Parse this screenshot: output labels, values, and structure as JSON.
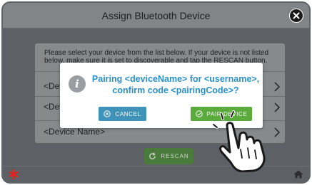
{
  "window": {
    "title": "Assign Bluetooth Device"
  },
  "list": {
    "instructions": "Please select your device from the list below. If your device is not listed below, make sure it is set to discoverable and tap the RESCAN button.",
    "rows": [
      {
        "label": "<Device Name>"
      },
      {
        "label": "<Device Name>"
      },
      {
        "label": "<Device Name>"
      }
    ]
  },
  "rescan_button": {
    "label": "RESCAN"
  },
  "dialog": {
    "message": "Pairing <deviceName> for <username>, confirm code <pairingCode>?",
    "cancel_label": "CANCEL",
    "pair_label": "PAIR DEVICE"
  },
  "icons": {
    "close": "close-icon",
    "info": "info-icon",
    "chevron": "chevron-right-icon",
    "refresh": "refresh-icon",
    "x_circle": "x-circle-icon",
    "check_circle": "check-circle-icon",
    "asterisk": "asterisk-icon",
    "home": "home-icon",
    "hand": "pointing-hand-icon"
  },
  "colors": {
    "accent_blue": "#2a90c8",
    "cancel_button": "#3f93b8",
    "pair_button": "#5aab3b",
    "rescan_button": "#4a7a3c",
    "asterisk": "#e2231a"
  }
}
